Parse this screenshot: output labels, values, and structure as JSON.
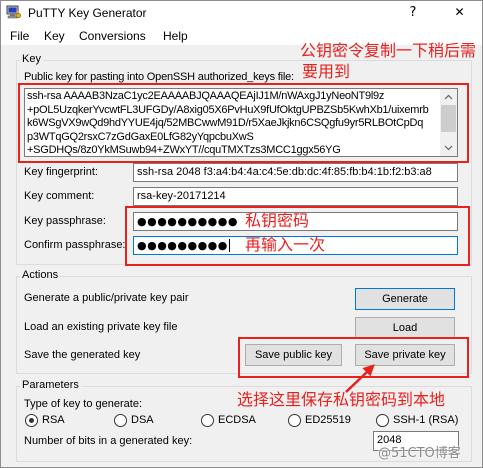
{
  "window": {
    "title": "PuTTY Key Generator",
    "help_button": "?",
    "close_button": "✕",
    "app_icon": "puttygen-icon"
  },
  "menu": {
    "items": [
      "File",
      "Key",
      "Conversions",
      "Help"
    ]
  },
  "key_group": {
    "label": "Key",
    "public_key_label": "Public key for pasting into OpenSSH authorized_keys file:",
    "public_key_lines": [
      "ssh-rsa AAAAB3NzaC1yc2EAAAABJQAAAQEAjIJ1M/nWAxgJ1yNeoNT9l9z",
      "+pOL5UzqkerYvcwtFL3UFGDy/A8xig05X6PvHuX9fUfOktgUPBZSb5KwhXb1/uixemrb",
      "k6WSgVX9wQd9hdYYUE4jq/52MBCwwM91D/r5XaeJkjkn6CSQgfu9yr5RLBOtCpDq",
      "p3WTqGQ2rsxC7zGdGaxE0LfG82yYqpcbuXwS",
      "+SGDHQs/8z0YkMSuwb94+ZWxYT//cquTMXTzs3MCC1ggx56YG"
    ],
    "fingerprint_label": "Key fingerprint:",
    "fingerprint_value": "ssh-rsa 2048 f3:a4:b4:4a:c4:5e:db:dc:4f:85:fb:b4:1b:f2:b3:a8",
    "comment_label": "Key comment:",
    "comment_value": "rsa-key-20171214",
    "passphrase_label": "Key passphrase:",
    "passphrase_value": "●●●●●●●●●●",
    "confirm_label": "Confirm passphrase:",
    "confirm_value": "●●●●●●●●●"
  },
  "actions_group": {
    "label": "Actions",
    "generate_text": "Generate a public/private key pair",
    "generate_button": "Generate",
    "load_text": "Load an existing private key file",
    "load_button": "Load",
    "save_text": "Save the generated key",
    "save_public_button": "Save public key",
    "save_private_button": "Save private key"
  },
  "parameters_group": {
    "label": "Parameters",
    "type_label": "Type of key to generate:",
    "key_types": [
      {
        "label": "RSA",
        "selected": true
      },
      {
        "label": "DSA",
        "selected": false
      },
      {
        "label": "ECDSA",
        "selected": false
      },
      {
        "label": "ED25519",
        "selected": false
      },
      {
        "label": "SSH-1 (RSA)",
        "selected": false
      }
    ],
    "bits_label": "Number of bits in a generated key:",
    "bits_value": "2048"
  },
  "annotations": {
    "public_key_note_line1": "公钥密令复制一下稍后需",
    "public_key_note_line2": "要用到",
    "passphrase_note": "私钥密码",
    "confirm_note": "再输入一次",
    "save_note": "选择这里保存私钥密码到本地"
  },
  "watermark": "@51CTO博客",
  "colors": {
    "annotation": "#e8211f",
    "focus_border": "#0078d7",
    "dialog_background": "#f0f0f0",
    "button_background": "#e1e1e1"
  }
}
